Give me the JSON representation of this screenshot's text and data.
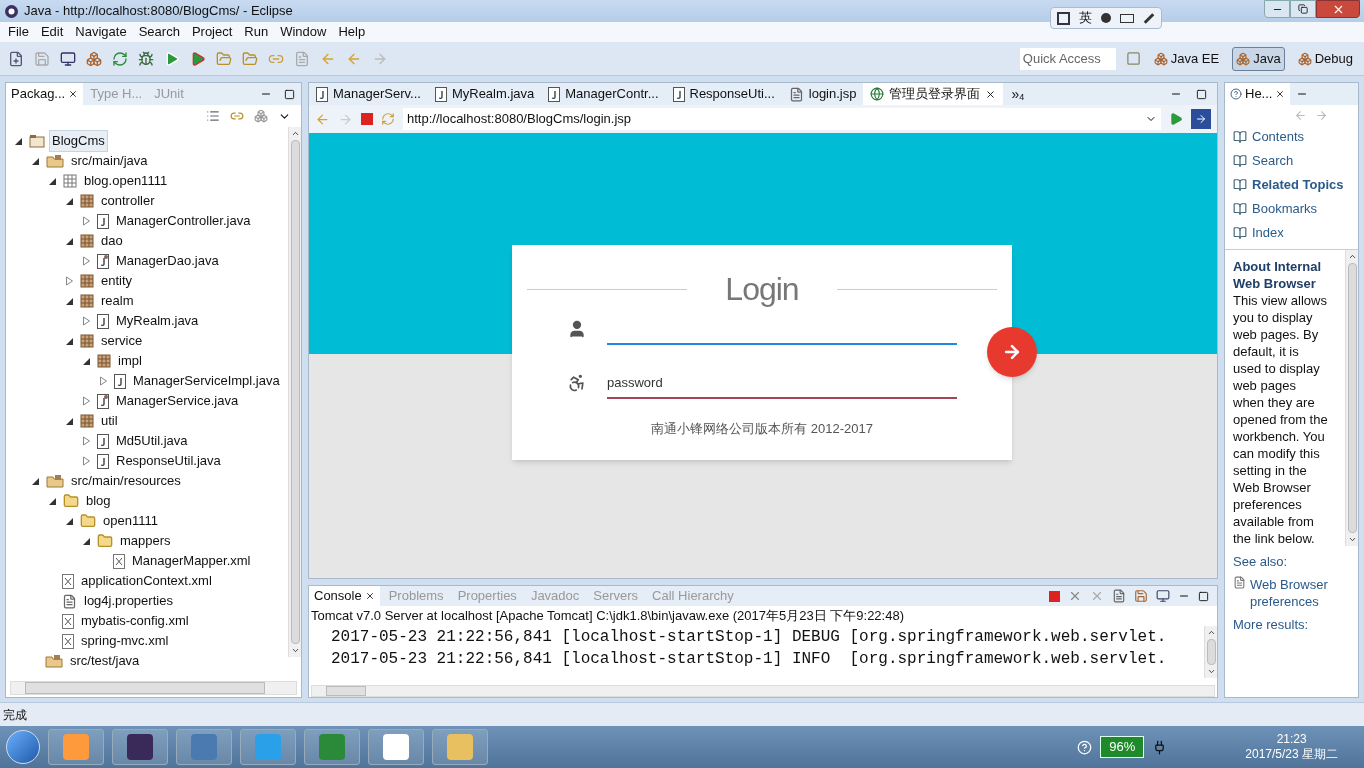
{
  "window": {
    "title": "Java - http://localhost:8080/BlogCms/ - Eclipse"
  },
  "ime_bar": {
    "language": "英"
  },
  "menu": [
    "File",
    "Edit",
    "Navigate",
    "Search",
    "Project",
    "Run",
    "Window",
    "Help"
  ],
  "toolbar": {
    "quick_access": {
      "placeholder": "Quick Access"
    },
    "perspectives": [
      {
        "label": "Java EE",
        "selected": false
      },
      {
        "label": "Java",
        "selected": true
      },
      {
        "label": "Debug",
        "selected": false
      }
    ]
  },
  "left_panel": {
    "tabs": [
      {
        "label": "Packag...",
        "selected": true
      },
      {
        "label": "Type H...",
        "selected": false
      },
      {
        "label": "JUnit",
        "selected": false
      }
    ],
    "tree": [
      {
        "label": "BlogCms",
        "kind": "project",
        "expanded": true,
        "selected": true,
        "children": [
          {
            "label": "src/main/java",
            "kind": "source",
            "expanded": true,
            "children": [
              {
                "label": "blog.open1111",
                "kind": "package-empty",
                "expanded": true,
                "children": [
                  {
                    "label": "controller",
                    "kind": "package",
                    "expanded": true,
                    "children": [
                      {
                        "label": "ManagerController.java",
                        "kind": "java",
                        "expanded": false
                      }
                    ]
                  },
                  {
                    "label": "dao",
                    "kind": "package",
                    "expanded": true,
                    "children": [
                      {
                        "label": "ManagerDao.java",
                        "kind": "interface",
                        "expanded": false
                      }
                    ]
                  },
                  {
                    "label": "entity",
                    "kind": "package",
                    "expanded": false
                  },
                  {
                    "label": "realm",
                    "kind": "package",
                    "expanded": true,
                    "children": [
                      {
                        "label": "MyRealm.java",
                        "kind": "java",
                        "expanded": false
                      }
                    ]
                  },
                  {
                    "label": "service",
                    "kind": "package",
                    "expanded": true,
                    "children": [
                      {
                        "label": "impl",
                        "kind": "package",
                        "expanded": true,
                        "children": [
                          {
                            "label": "ManagerServiceImpl.java",
                            "kind": "java",
                            "expanded": false
                          }
                        ]
                      },
                      {
                        "label": "ManagerService.java",
                        "kind": "interface",
                        "expanded": false
                      }
                    ]
                  },
                  {
                    "label": "util",
                    "kind": "package",
                    "expanded": true,
                    "children": [
                      {
                        "label": "Md5Util.java",
                        "kind": "java",
                        "expanded": false
                      },
                      {
                        "label": "ResponseUtil.java",
                        "kind": "java",
                        "expanded": false
                      }
                    ]
                  }
                ]
              }
            ]
          },
          {
            "label": "src/main/resources",
            "kind": "source",
            "expanded": true,
            "children": [
              {
                "label": "blog",
                "kind": "folder",
                "expanded": true,
                "children": [
                  {
                    "label": "open1111",
                    "kind": "folder",
                    "expanded": true,
                    "children": [
                      {
                        "label": "mappers",
                        "kind": "folder",
                        "expanded": true,
                        "children": [
                          {
                            "label": "ManagerMapper.xml",
                            "kind": "xml"
                          }
                        ]
                      }
                    ]
                  }
                ]
              },
              {
                "label": "applicationContext.xml",
                "kind": "xml"
              },
              {
                "label": "log4j.properties",
                "kind": "file"
              },
              {
                "label": "mybatis-config.xml",
                "kind": "xml"
              },
              {
                "label": "spring-mvc.xml",
                "kind": "xml"
              }
            ]
          },
          {
            "label": "src/test/java",
            "kind": "source"
          }
        ]
      }
    ]
  },
  "editor_tabs": [
    {
      "label": "ManagerServ...",
      "kind": "java",
      "selected": false
    },
    {
      "label": "MyRealm.java",
      "kind": "java",
      "selected": false
    },
    {
      "label": "ManagerContr...",
      "kind": "java",
      "selected": false
    },
    {
      "label": "ResponseUti...",
      "kind": "java",
      "selected": false
    },
    {
      "label": "login.jsp",
      "kind": "file",
      "selected": false
    },
    {
      "label": "管理员登录界面",
      "kind": "web",
      "selected": true
    }
  ],
  "editor_overflow": {
    "glyph": "»",
    "count": "4"
  },
  "browser": {
    "url": "http://localhost:8080/BlogCms/login.jsp",
    "page": {
      "title": "Login",
      "username": {
        "focused": true
      },
      "password": {
        "placeholder": "password",
        "focused": false
      },
      "footer": "南通小锋网络公司版本所有 2012-2017"
    }
  },
  "console": {
    "tabs": [
      {
        "label": "Console",
        "selected": true
      },
      {
        "label": "Problems",
        "selected": false
      },
      {
        "label": "Properties",
        "selected": false
      },
      {
        "label": "Javadoc",
        "selected": false
      },
      {
        "label": "Servers",
        "selected": false
      },
      {
        "label": "Call Hierarchy",
        "selected": false
      }
    ],
    "description": "Tomcat v7.0 Server at localhost [Apache Tomcat] C:\\jdk1.8\\bin\\javaw.exe (2017年5月23日 下午9:22:48)",
    "lines": [
      "2017-05-23 21:22:56,841 [localhost-startStop-1] DEBUG [org.springframework.web.servlet.",
      "2017-05-23 21:22:56,841 [localhost-startStop-1] INFO  [org.springframework.web.servlet."
    ]
  },
  "help_panel": {
    "tab": "He...",
    "nav": [
      {
        "label": "Contents",
        "selected": false
      },
      {
        "label": "Search",
        "selected": false
      },
      {
        "label": "Related Topics",
        "selected": true
      },
      {
        "label": "Bookmarks",
        "selected": false
      },
      {
        "label": "Index",
        "selected": false
      }
    ],
    "heading": "About Internal Web Browser",
    "body": "This view allows you to display web pages. By default, it is used to display web pages when they are opened from the workbench. You can modify this setting in the Web Browser preferences available from the link below.",
    "see_also": "See also:",
    "link": "Web Browser preferences",
    "more_results": "More results:"
  },
  "status_bar": {
    "text": "完成"
  },
  "taskbar": {
    "battery": "96%",
    "time": "21:23",
    "date": "2017/5/23 星期二"
  }
}
